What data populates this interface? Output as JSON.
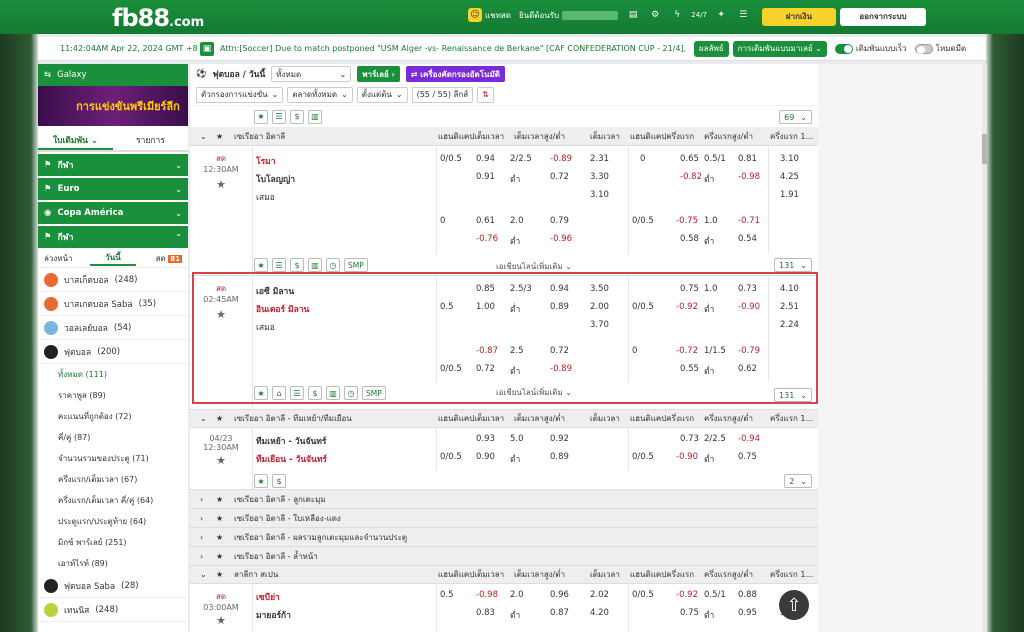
{
  "topbar": {
    "logo": "fb88",
    "logo_suffix": ".com",
    "chat": "แชทสด",
    "welcome": "ยินดีต้อนรับ",
    "deposit": "ฝากเงิน",
    "logout": "ออกจากระบบ"
  },
  "ticker": {
    "time": "11:42:04AM Apr 22, 2024 GMT +8",
    "news": "Attn:[Soccer] Due to match postponed \"USM Alger -vs- Renaissance de Berkane\" [CAF CONFEDERATION CUP - 21/4],",
    "results": "ผลลัพธ์",
    "odds_type": "การเดิมพันแบบมาเลย์",
    "quick_bet": "เดิมพันแบบเร็ว",
    "dark_mode": "โหมดมืด"
  },
  "sidebar": {
    "galaxy": "Galaxy",
    "banner": "การแข่งขันพรีเมียร์ลีก",
    "tabs": [
      "ใบเดิมพัน",
      "รายการ"
    ],
    "cats": [
      {
        "label": "กีฬา"
      },
      {
        "label": "Euro"
      },
      {
        "label": "Copa América"
      },
      {
        "label": "กีฬา"
      }
    ],
    "subtabs": [
      "ล่วงหน้า",
      "วันนี้",
      "สด"
    ],
    "live_count": "81",
    "sports": [
      {
        "label": "บาสเก็ตบอล",
        "count": "(248)"
      },
      {
        "label": "บาสเกตบอล Saba",
        "count": "(35)"
      },
      {
        "label": "วอลเลย์บอล",
        "count": "(54)"
      },
      {
        "label": "ฟุตบอล",
        "count": "(200)"
      }
    ],
    "leagues": [
      {
        "label": "ทั้งหมด",
        "count": "(111)"
      },
      {
        "label": "ราคาพูล",
        "count": "(89)"
      },
      {
        "label": "คะแนนที่ถูกต้อง",
        "count": "(72)"
      },
      {
        "label": "คี่/คู่",
        "count": "(87)"
      },
      {
        "label": "จำนวนรวมของประตู",
        "count": "(71)"
      },
      {
        "label": "ครึ่งแรก/เต็มเวลา",
        "count": "(67)"
      },
      {
        "label": "ครึ่งแรก/เต็มเวลา คี่/คู่",
        "count": "(64)"
      },
      {
        "label": "ประตูแรก/ประตูท้าย",
        "count": "(64)"
      },
      {
        "label": "มิกซ์ พาร์เลย์",
        "count": "(251)"
      },
      {
        "label": "เอาท์ไรท์",
        "count": "(89)"
      }
    ],
    "more_sports": [
      {
        "label": "ฟุตบอล Saba",
        "count": "(28)"
      },
      {
        "label": "เทนนิส",
        "count": "(248)"
      }
    ]
  },
  "main": {
    "title": "ฟุตบอล / วันนี้",
    "filter_all": "ทั้งหมด",
    "parlay": "พาร์เลย์",
    "promo": "เครื่องคัดกรองอัตโนมัติ",
    "f1": "ตัวกรองการแข่งขัน",
    "f2": "ตลาดทั้งหมด",
    "f3": "ตั้งแต่ต้น",
    "league_count": "(55 / 55) ลีกส์",
    "page_top": "69",
    "headers": [
      "แฮนดิแคปเต็มเวลา",
      "เต็มเวลาสูง/ต่ำ",
      "เต็มเวลา",
      "แฮนดิแคปครึ่งแรก",
      "ครึ่งแรกสูง/ต่ำ",
      "ครึ่งแรก 1..."
    ],
    "league1": "เซเรียอา อิตาลี",
    "m1": {
      "live": "สด",
      "time": "12:30AM",
      "home": "โรมา",
      "away": "โบโลญญ่า",
      "draw": "เสมอ",
      "r1": [
        "0/0.5",
        "0.94",
        "2/2.5",
        "-0.89",
        "2.31",
        "0",
        "0.65",
        "0.5/1",
        "0.81",
        "3.10"
      ],
      "r2": [
        "0.91",
        "ต่ำ",
        "0.72",
        "3.30",
        "-0.82",
        "ต่ำ",
        "-0.98",
        "4.25"
      ],
      "r3": [
        "3.10",
        "1.91"
      ],
      "r4": [
        "0",
        "0.61",
        "2.0",
        "0.79",
        "0/0.5",
        "-0.75",
        "1.0",
        "-0.71"
      ],
      "r5": [
        "-0.76",
        "ต่ำ",
        "-0.96",
        "0.58",
        "ต่ำ",
        "0.54"
      ],
      "more": "เอเชียนไลน์เพิ่มเติม",
      "count": "131"
    },
    "m2": {
      "live": "สด",
      "time": "02:45AM",
      "home": "เอซี มิลาน",
      "away": "อินเตอร์ มิลาน",
      "draw": "เสมอ",
      "r1": [
        "0.85",
        "2.5/3",
        "0.94",
        "3.50",
        "0.75",
        "1.0",
        "0.73",
        "4.10"
      ],
      "r2": [
        "0.5",
        "1.00",
        "ต่ำ",
        "0.89",
        "2.00",
        "0/0.5",
        "-0.92",
        "ต่ำ",
        "-0.90",
        "2.51"
      ],
      "r3": [
        "3.70",
        "2.24"
      ],
      "r4": [
        "-0.87",
        "2.5",
        "0.72",
        "0",
        "-0.72",
        "1/1.5",
        "-0.79"
      ],
      "r5": [
        "0/0.5",
        "0.72",
        "ต่ำ",
        "-0.89",
        "0.55",
        "ต่ำ",
        "0.62"
      ],
      "more": "เอเชียนไลน์เพิ่มเติม",
      "count": "131"
    },
    "league2": "เซเรียอา อิตาลี - ทีมเหย้า/ทีมเยือน",
    "m3": {
      "date": "04/23",
      "time": "12:30AM",
      "home": "ทีมเหย้า - วันจันทร์",
      "away": "ทีมเยือน - วันจันทร์",
      "r1": [
        "0.93",
        "5.0",
        "0.92",
        "0.73",
        "2/2.5",
        "-0.94"
      ],
      "r2": [
        "0/0.5",
        "0.90",
        "ต่ำ",
        "0.89",
        "0/0.5",
        "-0.90",
        "ต่ำ",
        "0.75"
      ],
      "count": "2"
    },
    "collapsed": [
      "เซเรียอา อิตาลี - ลูกเตะมุม",
      "เซเรียอา อิตาลี - ใบเหลือง-แดง",
      "เซเรียอา อิตาลี - ผลรวมลูกเตะมุมและจำนวนประตู",
      "เซเรียอา อิตาลี - ล้ำหน้า"
    ],
    "league3": "ลาลีกา สเปน",
    "m4": {
      "live": "สด",
      "time": "03:00AM",
      "home": "เซบีย่า",
      "away": "มายอร์ก้า",
      "r1": [
        "0.5",
        "-0.98",
        "2.0",
        "0.96",
        "2.02",
        "0/0.5",
        "-0.92",
        "0.5/1",
        "0.88"
      ],
      "r2": [
        "0.83",
        "ต่ำ",
        "0.87",
        "4.20",
        "0.75",
        "ต่ำ",
        "0.95",
        "5.60"
      ]
    }
  }
}
